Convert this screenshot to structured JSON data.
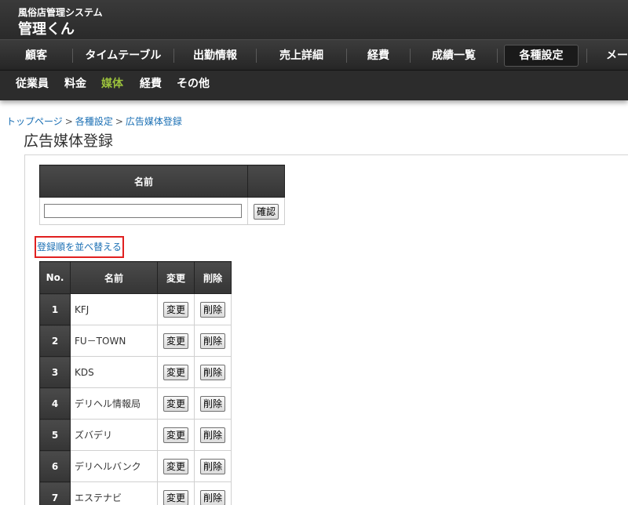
{
  "app": {
    "subtitle": "風俗店管理システム",
    "title": "管理くん"
  },
  "gnav": [
    {
      "label": "顧客"
    },
    {
      "label": "タイムテーブル"
    },
    {
      "label": "出勤情報"
    },
    {
      "label": "売上詳細"
    },
    {
      "label": "経費"
    },
    {
      "label": "成績一覧"
    },
    {
      "label": "各種設定"
    },
    {
      "label": "メール"
    }
  ],
  "snav": [
    {
      "label": "従業員"
    },
    {
      "label": "料金"
    },
    {
      "label": "媒体"
    },
    {
      "label": "経費"
    },
    {
      "label": "その他"
    }
  ],
  "breadcrumb": {
    "top": "トップページ",
    "settings": "各種設定",
    "current": "広告媒体登録",
    "sep": ">"
  },
  "page_title": "広告媒体登録",
  "form": {
    "header_name": "名前",
    "input_value": "",
    "confirm_label": "確認"
  },
  "reorder_link": "登録順を並べ替える",
  "list": {
    "headers": {
      "no": "No.",
      "name": "名前",
      "edit": "変更",
      "delete": "削除"
    },
    "edit_label": "変更",
    "delete_label": "削除",
    "rows": [
      {
        "no": "1",
        "name": "KFJ"
      },
      {
        "no": "2",
        "name": "FU－TOWN"
      },
      {
        "no": "3",
        "name": "KDS"
      },
      {
        "no": "4",
        "name": "デリヘル情報局"
      },
      {
        "no": "5",
        "name": "ズバデリ"
      },
      {
        "no": "6",
        "name": "デリヘルバンク"
      },
      {
        "no": "7",
        "name": "エステナビ"
      }
    ]
  },
  "colors": {
    "header_bg": "#2f2f2f",
    "active_subnav": "#9bc13c",
    "link": "#1a6fb4",
    "highlight_border": "#e02020"
  }
}
